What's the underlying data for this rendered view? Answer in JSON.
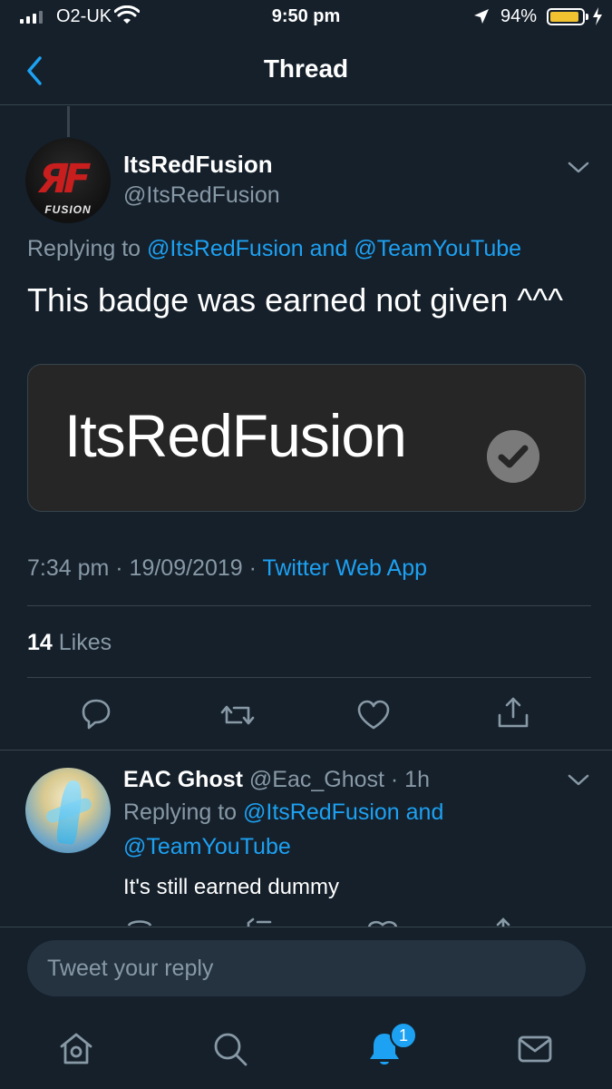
{
  "status_bar": {
    "carrier": "O2-UK",
    "time": "9:50 pm",
    "battery_percent": "94%",
    "battery_level": 0.94
  },
  "nav": {
    "title": "Thread"
  },
  "main_tweet": {
    "display_name": "ItsRedFusion",
    "handle": "@ItsRedFusion",
    "avatar_text": "FUSION",
    "replying_to_prefix": "Replying to",
    "replying_to_users": "@ItsRedFusion and @TeamYouTube",
    "text": "This badge was earned not given ^^^",
    "media_text": "ItsRedFusion",
    "timestamp": "7:34 pm · 19/09/2019 · ",
    "source": "Twitter Web App",
    "likes_count": "14",
    "likes_label": "Likes"
  },
  "reply": {
    "display_name": "EAC Ghost",
    "handle_and_time": "@Eac_Ghost · 1h",
    "replying_to_prefix": "Replying to",
    "replying_to_line1": "@ItsRedFusion and",
    "replying_to_line2": "@TeamYouTube",
    "text": "It's still earned dummy"
  },
  "compose": {
    "placeholder": "Tweet your reply"
  },
  "tab_bar": {
    "notification_count": "1"
  },
  "colors": {
    "background": "#15202b",
    "accent": "#1da1f2",
    "muted": "#8899a6",
    "divider": "#38444d"
  }
}
